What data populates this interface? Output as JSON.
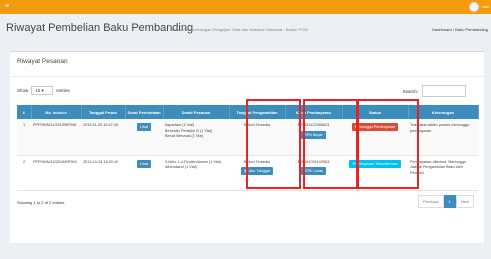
{
  "topbar": {
    "menu_icon": "≡",
    "user": "use"
  },
  "header": {
    "title": "Riwayat Pembelian Baku Pembanding",
    "subtitle": "Pusat Pengembangan Pengujian Obat dan Makanan Nasional - Badan POM",
    "breadcrumb": [
      "Dashboard",
      "Baku Pembanding"
    ]
  },
  "box": {
    "title": "Riwayat Pesanan",
    "show_label": "Show",
    "show_value": "10",
    "entries_label": "entries",
    "search_label": "Search:"
  },
  "table": {
    "headers": [
      "#",
      "No. Invoice",
      "Tanggal Pesan",
      "Surat Permintaan",
      "Detail Pesanan",
      "Tanggal Pengambilan",
      "Kode Pembayaran",
      "Status",
      "Keterangan"
    ],
    "rows": [
      {
        "no": "1",
        "invoice": "PPPOMN/11/2019/BP008",
        "tanggal": "2019-11-25 10:47:45",
        "surat_button": "Lihat",
        "detail": [
          "Aspartam (1 Vial)",
          "Benzatin Penisilin G (1 Vial)",
          "Benzil Benzoat (1 Vial)"
        ],
        "pengambilan": "Belum Tersedia",
        "pengambilan_button": "",
        "kode": "820191122985623",
        "kode_button": "SPB Bayar",
        "status": "Menunggu Pembayaran",
        "keterangan": "Transaksi dalam proses menunggu pembayaran"
      },
      {
        "no": "2",
        "invoice": "PPPOMN/10/2019/BP003",
        "tanggal": "2019-10-24 18:20:10",
        "surat_button": "Lihat",
        "detail": [
          "3-Nitro-1,4-Fenilendiamin (1 Vial)",
          "Albendazol (1 Vial)"
        ],
        "pengambilan": "Belum Tersedia",
        "pengambilan_button": "Atur Tanggal",
        "kode": "820191024102563",
        "kode_button": "SPB Lunas",
        "status": "Pembayaran Terkonfirmasi",
        "keterangan": "Pembayaran diterima. Menunggu Jadwal Pengambilan Baku oleh Pembeli"
      }
    ]
  },
  "footer": {
    "showing": "Showing 1 to 2 of 2 entries",
    "previous": "Previous",
    "page": "1",
    "next": "Next"
  }
}
